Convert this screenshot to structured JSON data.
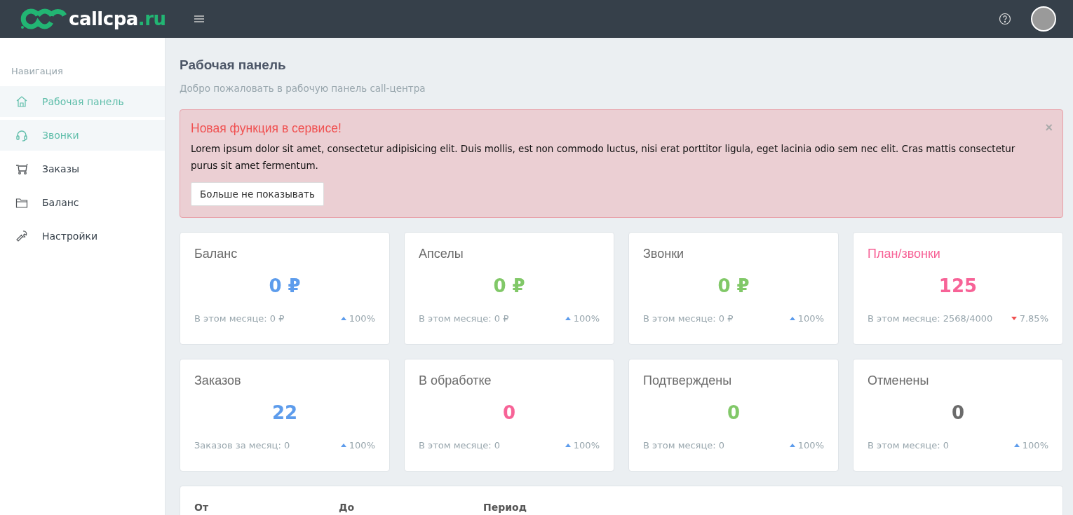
{
  "topbar": {
    "logo_text": "callcpa",
    "logo_suffix": ".ru"
  },
  "sidebar": {
    "heading": "Навигация",
    "items": [
      {
        "label": "Рабочая панель",
        "selected": true
      },
      {
        "label": "Звонки",
        "selected": true
      },
      {
        "label": "Заказы",
        "selected": false
      },
      {
        "label": "Баланс",
        "selected": false
      },
      {
        "label": "Настройки",
        "selected": false
      }
    ]
  },
  "page": {
    "title": "Рабочая панель",
    "subtitle": "Добро пожаловать в рабочую панель call-центра"
  },
  "alert": {
    "title": "Новая функция в сервисе!",
    "text": "Lorem ipsum dolor sit amet, consectetur adipisicing elit. Duis mollis, est non commodo luctus, nisi erat porttitor ligula, eget lacinia odio sem nec elit. Cras mattis consectetur purus sit amet fermentum.",
    "button": "Больше не показывать",
    "close": "×"
  },
  "stats": [
    {
      "title": "Баланс",
      "title_accented": false,
      "value": "0 ₽",
      "color": "#5d9cec",
      "note": "В этом месяце: 0 ₽",
      "kind": "up",
      "change": "100%"
    },
    {
      "title": "Апселы",
      "title_accented": false,
      "value": "0 ₽",
      "color": "#81c868",
      "note": "В этом месяце: 0 ₽",
      "kind": "up",
      "change": "100%"
    },
    {
      "title": "Звонки",
      "title_accented": false,
      "value": "0 ₽",
      "color": "#81c868",
      "note": "В этом месяце: 0 ₽",
      "kind": "up",
      "change": "100%"
    },
    {
      "title": "План/звонки",
      "title_accented": true,
      "value": "125",
      "color": "#f76397",
      "note": "В этом месяце: 2568/4000",
      "kind": "down",
      "change": "7.85%"
    },
    {
      "title": "Заказов",
      "title_accented": false,
      "value": "22",
      "color": "#5d9cec",
      "note": "Заказов за месяц: 0",
      "kind": "up",
      "change": "100%"
    },
    {
      "title": "В обработке",
      "title_accented": false,
      "value": "0",
      "color": "#f76397",
      "note": "В этом месяце: 0",
      "kind": "up",
      "change": "100%"
    },
    {
      "title": "Подтверждены",
      "title_accented": false,
      "value": "0",
      "color": "#81c868",
      "note": "В этом месяце: 0",
      "kind": "up",
      "change": "100%"
    },
    {
      "title": "Отменены",
      "title_accented": false,
      "value": "0",
      "color": "#6b6b6b",
      "note": "В этом месяце: 0",
      "kind": "up",
      "change": "100%"
    }
  ],
  "filter": {
    "labels": [
      "От",
      "До",
      "Период"
    ]
  }
}
